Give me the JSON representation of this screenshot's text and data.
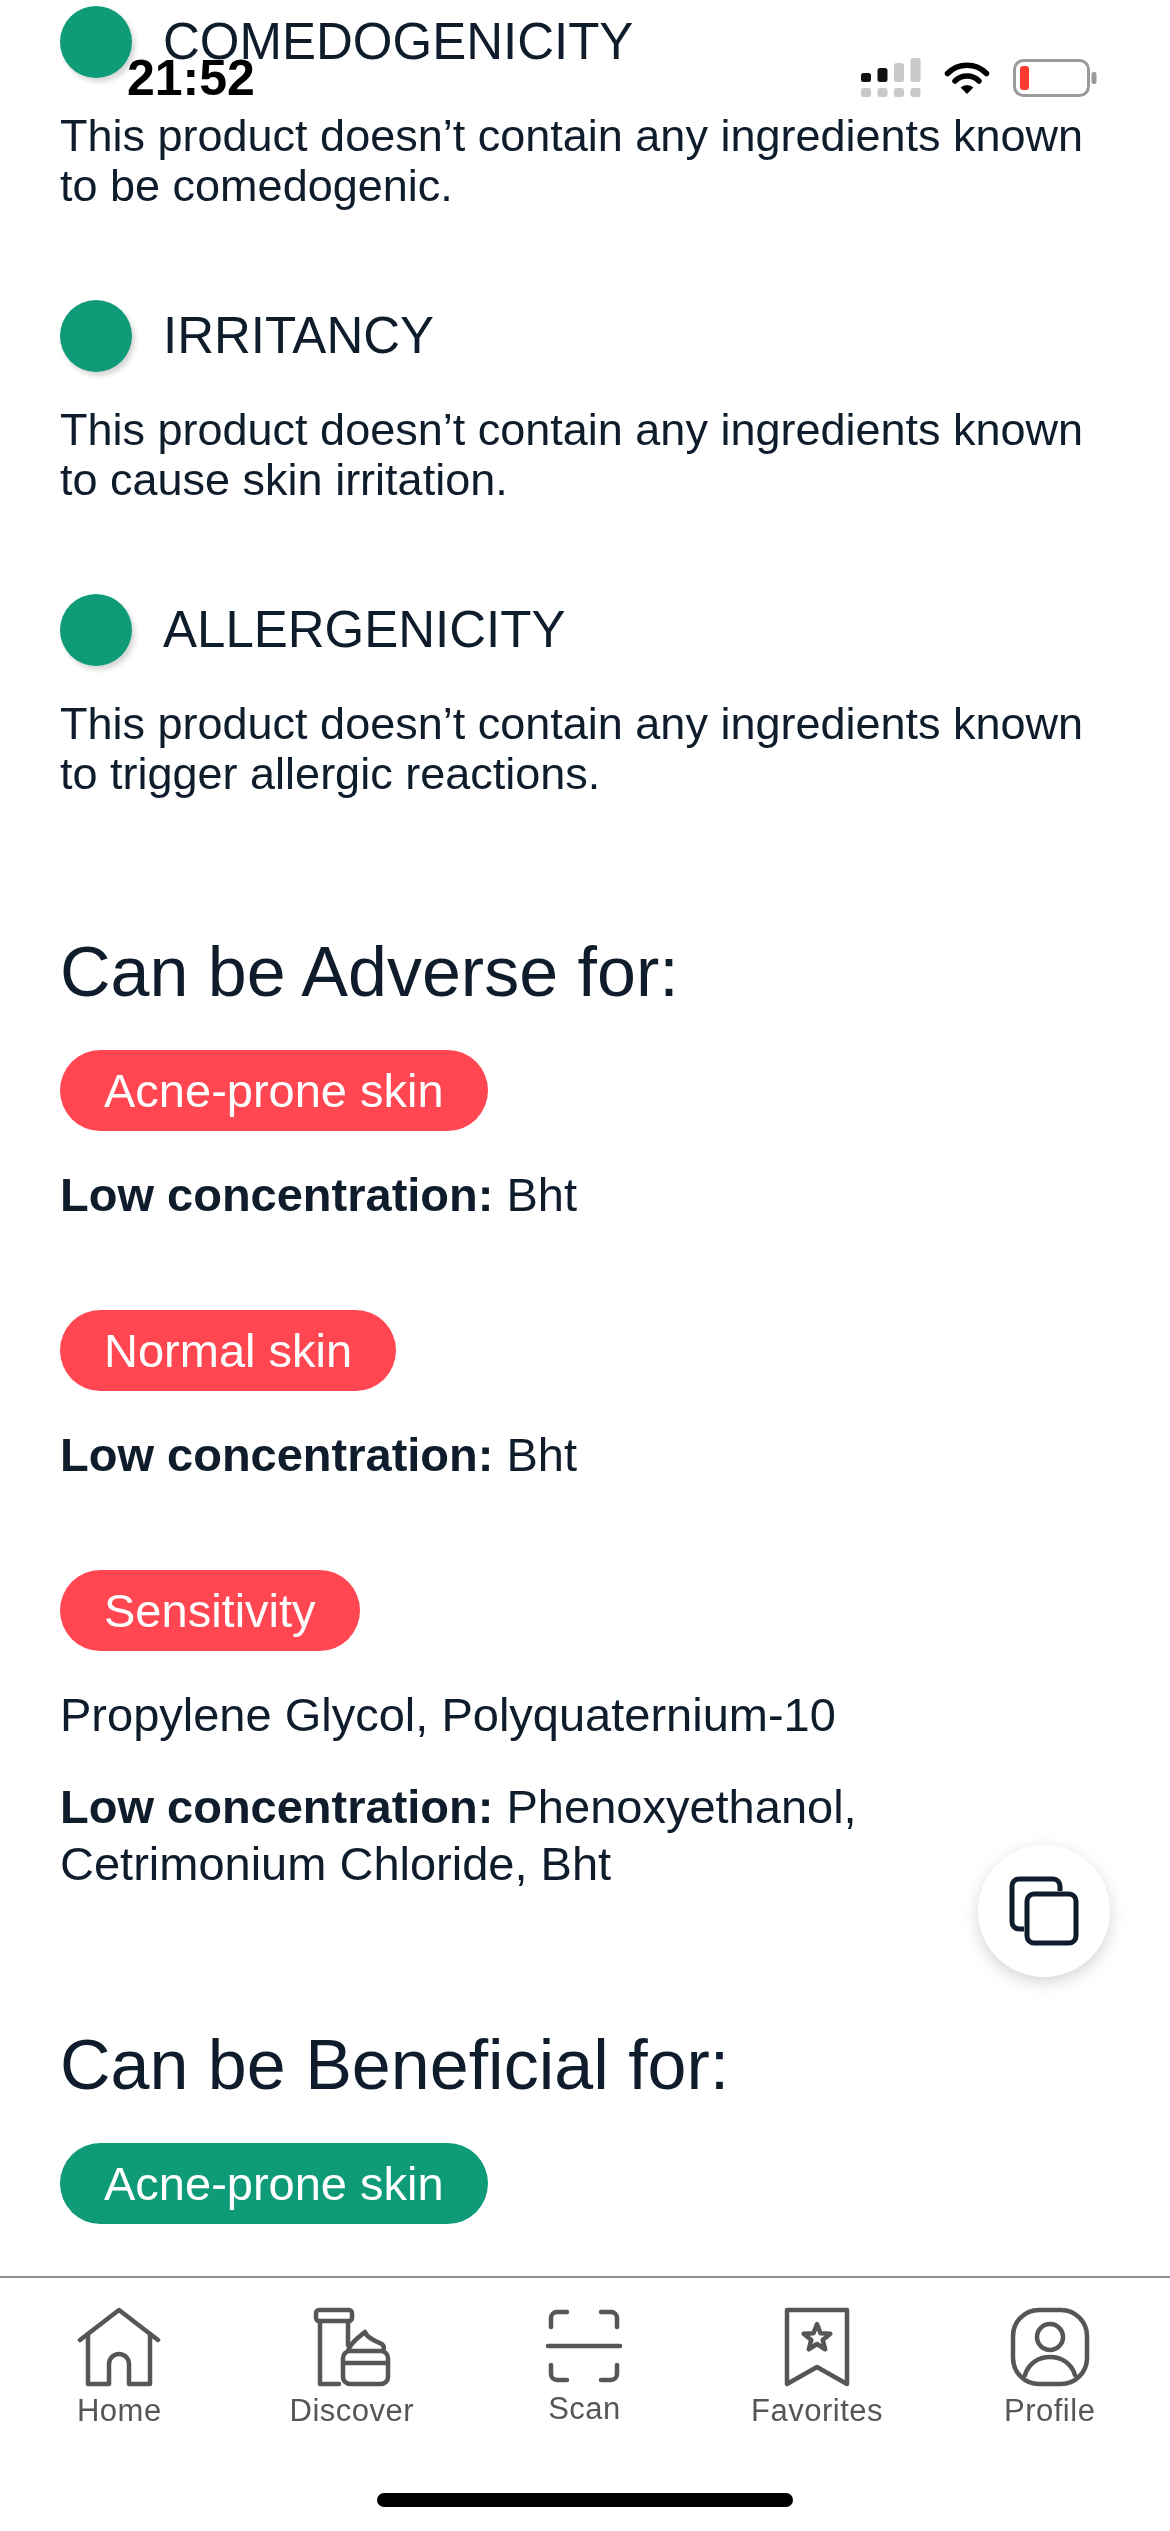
{
  "status_bar": {
    "time": "21:52"
  },
  "checks": [
    {
      "title": "COMEDOGENICITY",
      "description": "This product doesn’t contain any ingredients known to be comedogenic.",
      "color": "#0f9b77"
    },
    {
      "title": "IRRITANCY",
      "description": "This product doesn’t contain any ingredients known to cause skin irritation.",
      "color": "#0f9b77"
    },
    {
      "title": "ALLERGENICITY",
      "description": "This product doesn’t contain any ingredients known to trigger allergic reactions.",
      "color": "#0f9b77"
    }
  ],
  "adverse": {
    "heading": "Can be Adverse for:",
    "groups": [
      {
        "tag": "Acne-prone skin",
        "color": "#ff4651",
        "lines": [
          "**Low concentration:** Bht"
        ]
      },
      {
        "tag": "Normal skin",
        "color": "#ff4651",
        "lines": [
          "**Low concentration:** Bht"
        ]
      },
      {
        "tag": "Sensitivity",
        "color": "#ff4651",
        "lines": [
          "Propylene Glycol, Polyquaternium-10",
          "**Low concentration:** Phenoxyethanol, Cetrimonium Chloride, Bht"
        ]
      }
    ]
  },
  "beneficial": {
    "heading": "Can be Beneficial for:",
    "groups": [
      {
        "tag": "Acne-prone skin",
        "color": "#0f9b77"
      }
    ]
  },
  "tab_bar": {
    "items": [
      {
        "label": "Home",
        "selected": false
      },
      {
        "label": "Discover",
        "selected": false
      },
      {
        "label": "Scan",
        "selected": false
      },
      {
        "label": "Favorites",
        "selected": false
      },
      {
        "label": "Profile",
        "selected": false
      }
    ]
  }
}
